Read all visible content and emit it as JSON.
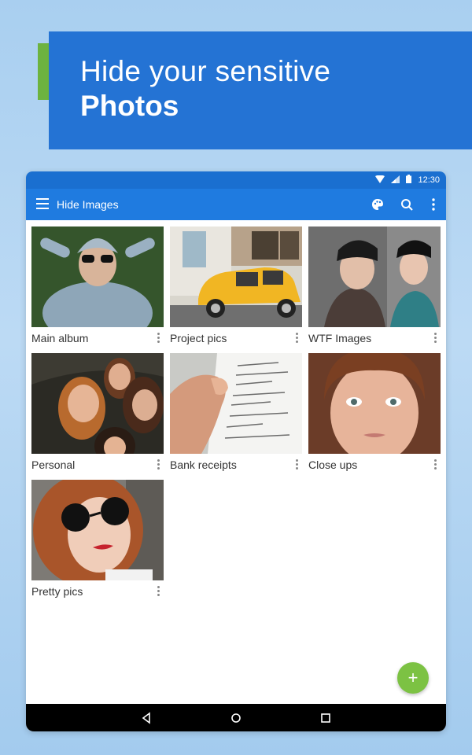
{
  "banner": {
    "line1": "Hide your sensitive",
    "line2": "Photos",
    "accent_color": "#6db33f",
    "background_color": "#2473d4"
  },
  "statusbar": {
    "time": "12:30",
    "icons": [
      "wifi-icon",
      "signal-icon",
      "battery-icon"
    ]
  },
  "appbar": {
    "title": "Hide Images",
    "actions": [
      "theme-palette-icon",
      "search-icon",
      "more-vert-icon"
    ],
    "color": "#1f7be0"
  },
  "albums": [
    {
      "label": "Main album"
    },
    {
      "label": "Project pics"
    },
    {
      "label": "WTF Images"
    },
    {
      "label": "Personal"
    },
    {
      "label": "Bank receipts"
    },
    {
      "label": "Close ups"
    },
    {
      "label": "Pretty pics"
    }
  ],
  "fab": {
    "symbol": "+",
    "color": "#7cc243"
  },
  "navbar": {
    "buttons": [
      "back-icon",
      "home-icon",
      "recents-icon"
    ]
  }
}
